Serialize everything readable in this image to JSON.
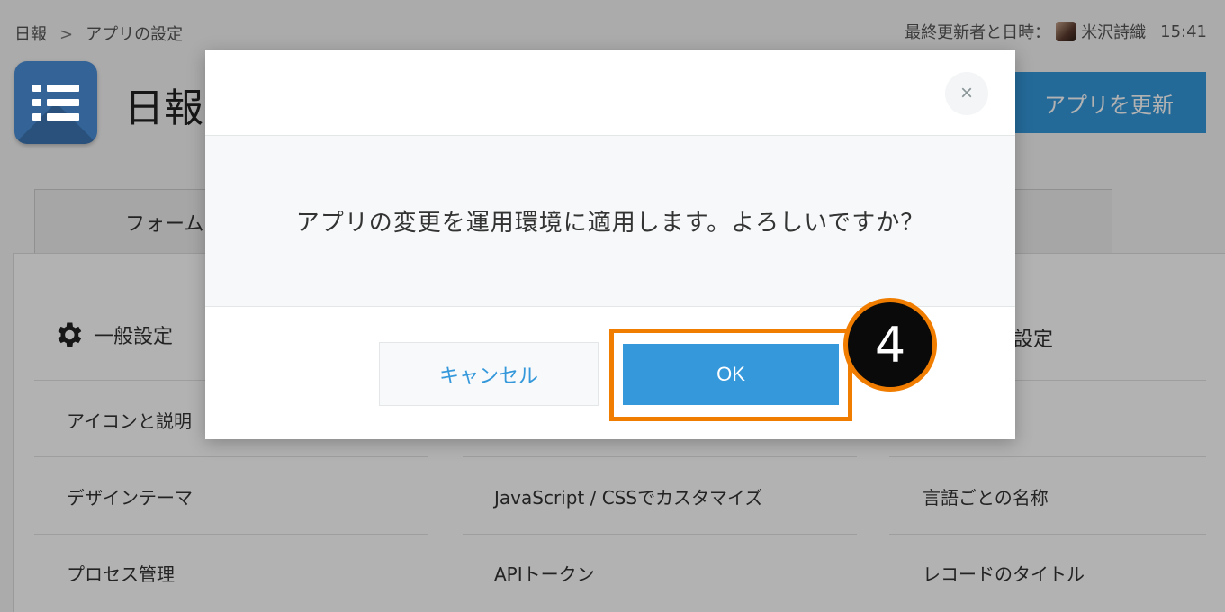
{
  "header": {
    "breadcrumb": [
      "日報",
      "アプリの設定"
    ],
    "breadcrumb_separator": ">",
    "updater_label": "最終更新者と日時：",
    "updater_name": "米沢詩織",
    "updated_time": "15:41"
  },
  "app": {
    "name": "日報",
    "update_button": "アプリを更新",
    "icon": "list-icon"
  },
  "tabs": {
    "form_tab": "フォーム"
  },
  "settings": {
    "general_title": "一般設定",
    "general_icon": "gear-icon",
    "other_title": "の設定",
    "column1": [
      "アイコンと説明",
      "デザインテーマ",
      "プロセス管理"
    ],
    "column2": [
      "JavaScript / CSSでカスタマイズ",
      "APIトークン"
    ],
    "column3": [
      "言語ごとの名称",
      "レコードのタイトル"
    ]
  },
  "dialog": {
    "close_icon": "×",
    "message": "アプリの変更を運用環境に適用します。よろしいですか？",
    "cancel_label": "キャンセル",
    "ok_label": "OK"
  },
  "annotation": {
    "step_number": "4"
  },
  "colors": {
    "primary": "#3498db",
    "highlight": "#f07d00",
    "badge": "#0a0a0a"
  }
}
